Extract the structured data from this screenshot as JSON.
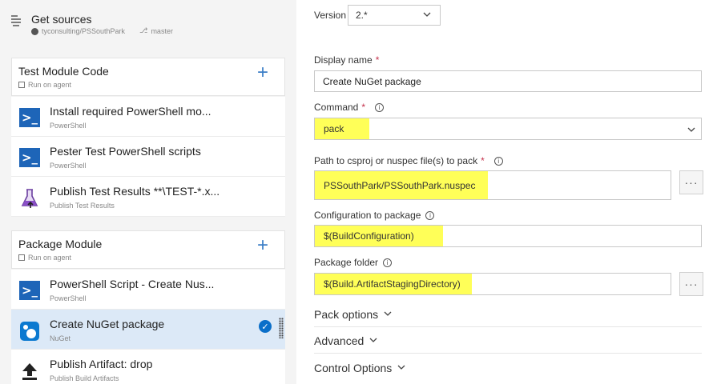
{
  "get_sources": {
    "title": "Get sources",
    "repo": "tyconsulting/PSSouthPark",
    "branch": "master"
  },
  "phases": [
    {
      "title": "Test Module Code",
      "subtitle": "Run on agent"
    },
    {
      "title": "Package Module",
      "subtitle": "Run on agent"
    }
  ],
  "tasks": [
    {
      "title": "Install required PowerShell mo...",
      "subtitle": "PowerShell"
    },
    {
      "title": "Pester Test PowerShell scripts",
      "subtitle": "PowerShell"
    },
    {
      "title": "Publish Test Results **\\TEST-*.x...",
      "subtitle": "Publish Test Results"
    },
    {
      "title": "PowerShell Script - Create Nus...",
      "subtitle": "PowerShell"
    },
    {
      "title": "Create NuGet package",
      "subtitle": "NuGet"
    },
    {
      "title": "Publish Artifact: drop",
      "subtitle": "Publish Build Artifacts"
    }
  ],
  "icons": {
    "powershell": "powershell-icon",
    "test_results": "flask-icon",
    "nuget": "nuget-icon",
    "publish": "upload-icon"
  },
  "form": {
    "version_label": "Version",
    "version_value": "2.*",
    "display_name_label": "Display name",
    "display_name_value": "Create NuGet package",
    "command_label": "Command",
    "command_value": "pack",
    "path_label": "Path to csproj or nuspec file(s) to pack",
    "path_value": "PSSouthPark/PSSouthPark.nuspec",
    "config_label": "Configuration to package",
    "config_value": "$(BuildConfiguration)",
    "folder_label": "Package folder",
    "folder_value": "$(Build.ArtifactStagingDirectory)",
    "required_mark": "*",
    "info_glyph": "i",
    "dots_glyph": "···"
  },
  "sections": [
    "Pack options",
    "Advanced",
    "Control Options"
  ],
  "colors": {
    "accent": "#3b7ec6",
    "highlight": "#ffff58",
    "selected_row": "#dce9f7",
    "ps_blue": "#1e65b8"
  }
}
